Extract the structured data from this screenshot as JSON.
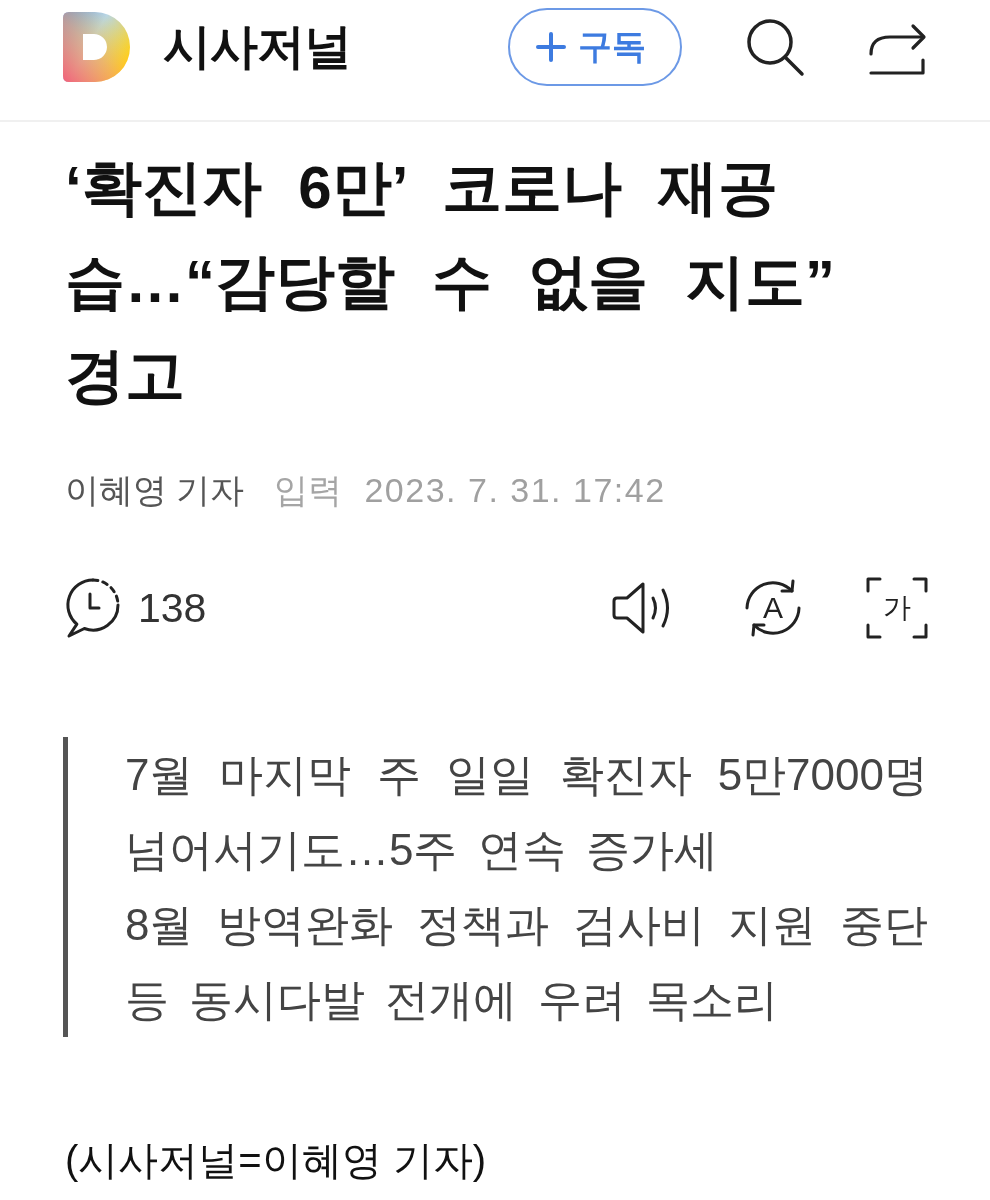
{
  "header": {
    "site_name": "시사저널",
    "subscribe_button": {
      "label": "구독"
    }
  },
  "article": {
    "title": "‘확진자 6만’ 코로나 재공습…“감당할 수 없을 지도” 경고",
    "byline": {
      "author": "이혜영 기자",
      "label": "입력",
      "datetime": "2023. 7. 31. 17:42"
    }
  },
  "toolbar": {
    "comment_count": "138",
    "translate_label": "A",
    "text_size_label": "가"
  },
  "summary": [
    "7월 마지막 주 일일 확진자 5만7000명 넘어서기도…5주 연속 증가세",
    "8월 방역완화 정책과 검사비 지원 중단 등 동시다발 전개에 우려 목소리"
  ],
  "body": [
    "(시사저널=이혜영 기자)"
  ]
}
